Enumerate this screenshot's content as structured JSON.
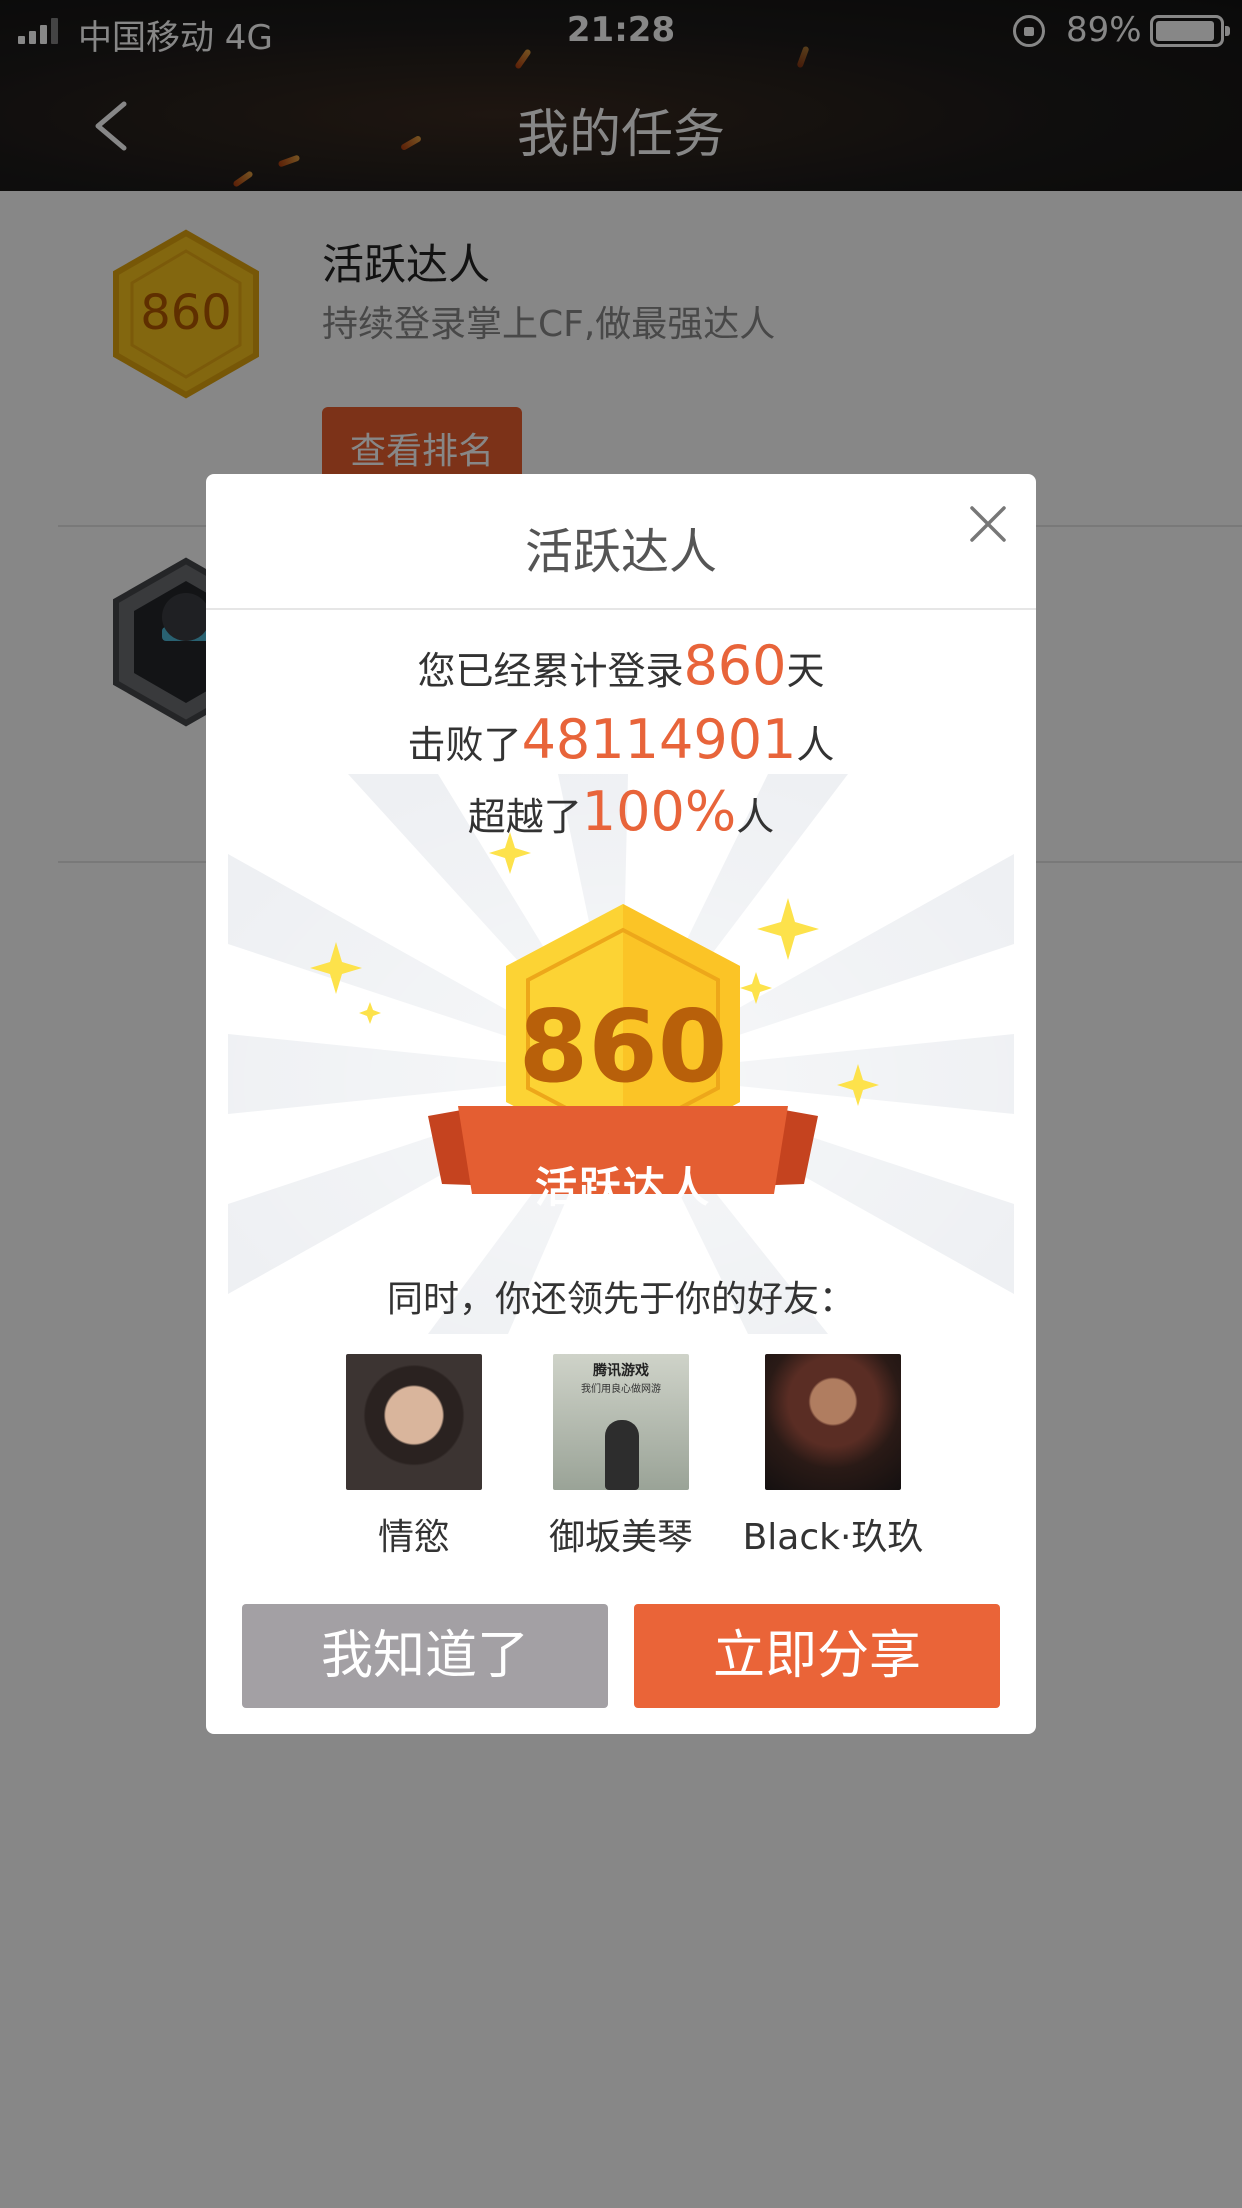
{
  "status_bar": {
    "carrier": "中国移动  4G",
    "time": "21:28",
    "battery": "89%"
  },
  "nav": {
    "title": "我的任务"
  },
  "tasks": [
    {
      "badge_value": "860",
      "name": "活跃达人",
      "description": "持续登录掌上CF,做最强达人",
      "button_label": "查看排名"
    }
  ],
  "modal": {
    "title": "活跃达人",
    "stats": [
      {
        "prefix": "您已经累计登录",
        "value": "860",
        "suffix": "天"
      },
      {
        "prefix": "击败了",
        "value": "48114901",
        "suffix": "人"
      },
      {
        "prefix": "超越了",
        "value": "100%",
        "suffix": "人"
      }
    ],
    "badge_value": "860",
    "badge_label": "活跃达人",
    "friends_title": "同时，你还领先于你的好友：",
    "friends": [
      {
        "name": "情慾"
      },
      {
        "name": "御坂美琴"
      },
      {
        "name": "Black·玖玖"
      }
    ],
    "avatar2_text": "腾讯游戏",
    "avatar2_subtext": "我们用良心做网游",
    "ok_label": "我知道了",
    "share_label": "立即分享"
  },
  "colors": {
    "accent": "#ea6438",
    "highlight": "#e8643a",
    "button_gray": "#a3a0a4",
    "badge_gold": "#fcd334"
  }
}
